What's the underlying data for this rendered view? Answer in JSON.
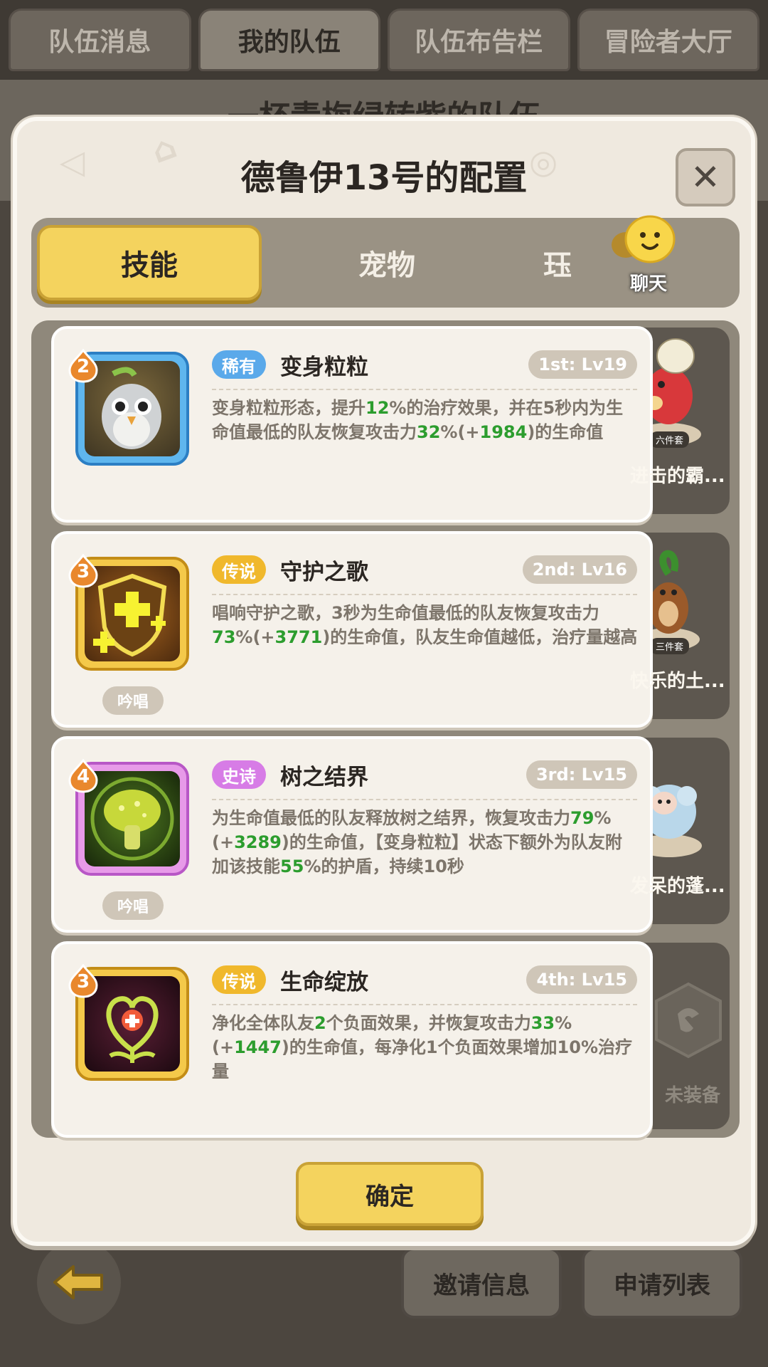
{
  "top_tabs": [
    "队伍消息",
    "我的队伍",
    "队伍布告栏",
    "冒险者大厅"
  ],
  "bg_title": "一杯青梅绿转紫的队伍",
  "modal": {
    "title": "德鲁伊13号的配置",
    "close_symbol": "✕"
  },
  "tabs": {
    "skill": "技能",
    "pet": "宠物",
    "equip_partial": "珏",
    "chat": "聊天"
  },
  "skills": [
    {
      "tier": "2",
      "rarity": "稀有",
      "rarity_color": "#5aa9ea",
      "name": "变身粒粒",
      "level": "1st: Lv19",
      "desc_1": "变身粒粒形态，提升",
      "g1": "12",
      "desc_2": "%的治疗效果，并在5秒内为生命值最低的队友恢复攻击力",
      "g2": "32",
      "desc_3": "%(+",
      "g3": "1984",
      "desc_4": ")的生命值",
      "chant": "",
      "pet_name": "进击的霸...",
      "pet_set": "六件套"
    },
    {
      "tier": "3",
      "rarity": "传说",
      "rarity_color": "#f0b82c",
      "name": "守护之歌",
      "level": "2nd: Lv16",
      "desc_1": "唱响守护之歌，3秒为生命值最低的队友恢复攻击力",
      "g1": "73",
      "desc_2": "%(+",
      "g2": "3771",
      "desc_3": ")的生命值，队友生命值越低，治疗量越高",
      "chant": "吟唱",
      "pet_name": "快乐的土...",
      "pet_set": "三件套"
    },
    {
      "tier": "4",
      "rarity": "史诗",
      "rarity_color": "#d77ce6",
      "name": "树之结界",
      "level": "3rd: Lv15",
      "desc_1": "为生命值最低的队友释放树之结界，恢复攻击力",
      "g1": "79",
      "desc_2": "%(+",
      "g2": "3289",
      "desc_3": ")的生命值，【变身粒粒】状态下额外为队友附加该技能",
      "g3": "55",
      "desc_4": "%的护盾，持续10秒",
      "chant": "吟唱",
      "pet_name": "发呆的蓬..."
    },
    {
      "tier": "3",
      "rarity": "传说",
      "rarity_color": "#f0b82c",
      "name": "生命绽放",
      "level": "4th: Lv15",
      "desc_1": "净化全体队友",
      "g1": "2",
      "desc_2": "个负面效果，并恢复攻击力",
      "g2": "33",
      "desc_3": "%(+",
      "g3": "1447",
      "desc_4": ")的生命值，每净化1个负面效果增加10%治疗量",
      "chant": "",
      "empty_label": "未装备"
    }
  ],
  "confirm": "确定",
  "bottom_buttons": {
    "invite": "邀请信息",
    "apply": "申请列表"
  }
}
